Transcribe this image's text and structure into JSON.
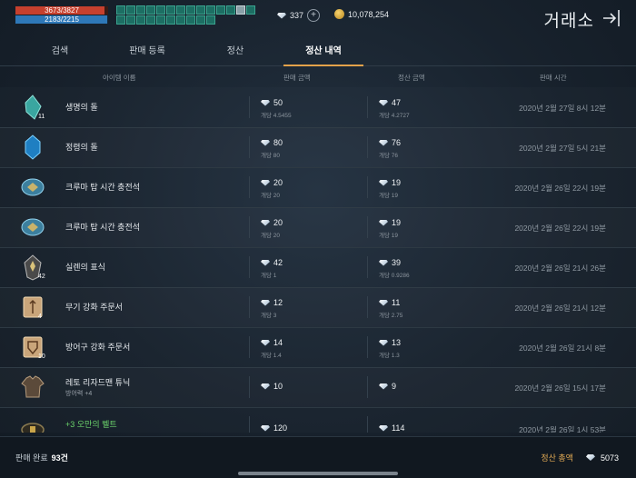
{
  "status": {
    "hp": "3673/3827",
    "mp": "2183/2215",
    "hp_fraction": 0.96,
    "mp_fraction": 0.99
  },
  "currency": {
    "diamonds": "337",
    "adena": "10,078,254",
    "diamond_icon": "diamond-icon",
    "add_icon": "plus-icon",
    "coin_icon": "adena-coin-icon"
  },
  "window": {
    "title": "거래소",
    "exit_icon": "exit-arrow-icon"
  },
  "tabs": [
    {
      "label": "검색"
    },
    {
      "label": "판매 등록"
    },
    {
      "label": "정산"
    },
    {
      "label": "정산 내역"
    }
  ],
  "columns": {
    "item_name": "아이템 이름",
    "sale_amount": "판매 금액",
    "settle_amount": "정산 금액",
    "sale_time": "판매 시간"
  },
  "rows": [
    {
      "name": "생명의 돌",
      "sub": "",
      "qty": "11",
      "icon": "life-stone-icon",
      "sale": "50",
      "sale_unit": "개당 4.5455",
      "settle": "47",
      "settle_unit": "개당 4.2727",
      "time": "2020년 2월 27일 8시 12분"
    },
    {
      "name": "정령의 돌",
      "sub": "",
      "qty": "",
      "icon": "spirit-stone-icon",
      "sale": "80",
      "sale_unit": "개당 80",
      "settle": "76",
      "settle_unit": "개당 76",
      "time": "2020년 2월 27일 5시 21분"
    },
    {
      "name": "크루마 탑 시간 충전석",
      "sub": "",
      "qty": "",
      "icon": "time-charge-stone-icon",
      "sale": "20",
      "sale_unit": "개당 20",
      "settle": "19",
      "settle_unit": "개당 19",
      "time": "2020년 2월 26일 22시 19분"
    },
    {
      "name": "크루마 탑 시간 충전석",
      "sub": "",
      "qty": "",
      "icon": "time-charge-stone-icon",
      "sale": "20",
      "sale_unit": "개당 20",
      "settle": "19",
      "settle_unit": "개당 19",
      "time": "2020년 2월 26일 22시 19분"
    },
    {
      "name": "실렌의 표식",
      "sub": "",
      "qty": "42",
      "icon": "shilen-mark-icon",
      "sale": "42",
      "sale_unit": "개당 1",
      "settle": "39",
      "settle_unit": "개당 0.9286",
      "time": "2020년 2월 26일 21시 26분"
    },
    {
      "name": "무기 강화 주문서",
      "sub": "",
      "qty": "4",
      "icon": "weapon-scroll-icon",
      "sale": "12",
      "sale_unit": "개당 3",
      "settle": "11",
      "settle_unit": "개당 2.75",
      "time": "2020년 2월 26일 21시 12분"
    },
    {
      "name": "방어구 강화 주문서",
      "sub": "",
      "qty": "10",
      "icon": "armor-scroll-icon",
      "sale": "14",
      "sale_unit": "개당 1.4",
      "settle": "13",
      "settle_unit": "개당 1.3",
      "time": "2020년 2월 26일 21시 8분"
    },
    {
      "name": "레토 리자드맨 튜닉",
      "sub": "방어력 +4",
      "qty": "",
      "icon": "tunic-icon",
      "sale": "10",
      "sale_unit": "",
      "settle": "9",
      "settle_unit": "",
      "time": "2020년 2월 26일 15시 17분"
    },
    {
      "name": "+3 오만의 벨트",
      "sub": "",
      "qty": "",
      "icon": "belt-icon",
      "sale": "120",
      "sale_unit": "",
      "settle": "114",
      "settle_unit": "",
      "time": "2020년 2월 26일 1시 53분",
      "green": true
    }
  ],
  "footer": {
    "completed_label": "판매 완료",
    "completed_value": "93건",
    "total_label": "정산 총액",
    "total_value": "5073"
  },
  "colors": {
    "tab_accent": "#e3a24a",
    "enchanted_item": "#6bd36b",
    "total_label": "#e0a954"
  }
}
